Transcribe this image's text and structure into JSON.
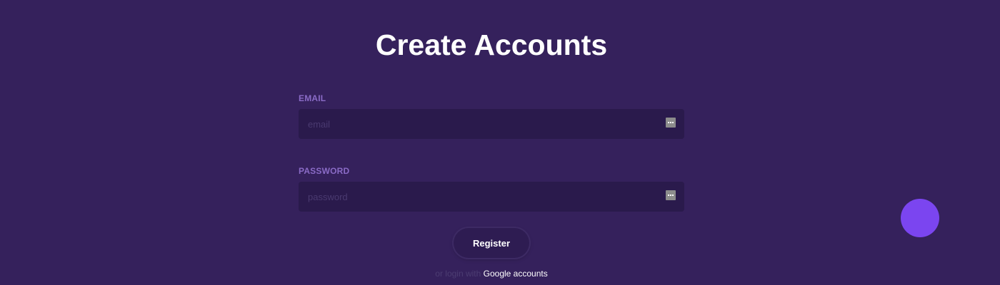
{
  "page": {
    "title": "Create Accounts"
  },
  "form": {
    "email": {
      "label": "EMAIL",
      "placeholder": "email",
      "value": "",
      "icon": "more-dots-icon"
    },
    "password": {
      "label": "PASSWORD",
      "placeholder": "password",
      "value": "",
      "icon": "more-dots-icon"
    },
    "register_label": "Register"
  },
  "alt_login": {
    "prefix": "or login with",
    "link_text": "Google accounts"
  },
  "colors": {
    "background": "#35215c",
    "input_background": "#2a1a4c",
    "label": "#8a6bc6",
    "accent": "#7b45f0"
  },
  "fab": {
    "icon": "floating-action-circle"
  }
}
